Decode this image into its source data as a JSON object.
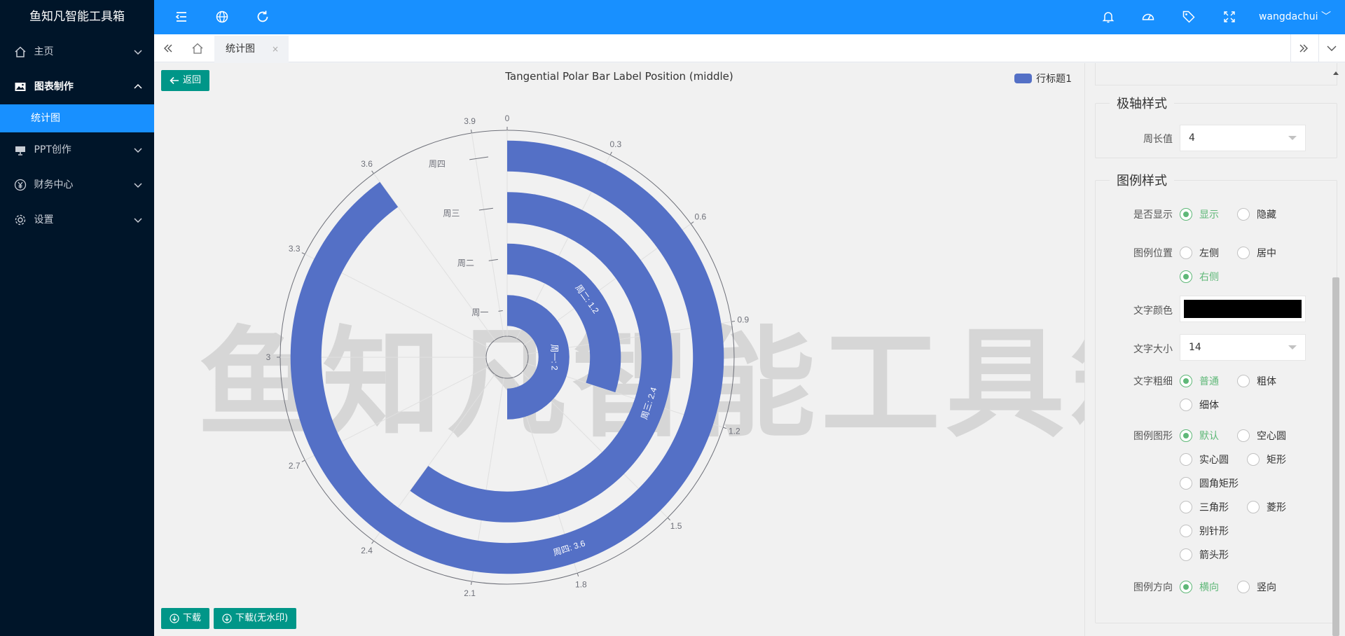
{
  "app": {
    "title": "鱼知凡智能工具箱"
  },
  "sidebar": {
    "items": [
      {
        "label": "主页",
        "icon": "home-icon"
      },
      {
        "label": "图表制作",
        "icon": "image-icon"
      },
      {
        "label": "PPT创作",
        "icon": "presentation-icon"
      },
      {
        "label": "财务中心",
        "icon": "yen-icon"
      },
      {
        "label": "设置",
        "icon": "gear-icon"
      }
    ],
    "active_sub": "统计图"
  },
  "topbar": {
    "icons": [
      "menu-fold-icon",
      "globe-icon",
      "refresh-icon",
      "bell-icon",
      "dashboard-icon",
      "tag-icon",
      "fullscreen-icon"
    ],
    "user": "wangdachui"
  },
  "tabs": {
    "active": "统计图",
    "close": "×"
  },
  "toolbar": {
    "back": "返回",
    "download": "下载",
    "download_nowm": "下载(无水印)"
  },
  "watermark": "鱼知凡智能工具箱",
  "chart_data": {
    "type": "bar",
    "coordinate_system": "polar",
    "bar_direction": "tangential",
    "title": "Tangential Polar Bar Label Position (middle)",
    "categories": [
      "周一",
      "周二",
      "周三",
      "周四"
    ],
    "series": [
      {
        "name": "行标题1",
        "values": [
          2,
          1.2,
          2.4,
          3.6
        ]
      }
    ],
    "data_labels": [
      "周一: 2",
      "周二: 1.2",
      "周三: 2.4",
      "周四: 3.6"
    ],
    "angle_axis": {
      "max": 4,
      "ticks": [
        "0",
        "0.3",
        "0.6",
        "0.9",
        "1.2",
        "1.5",
        "1.8",
        "2.1",
        "2.4",
        "2.7",
        "3",
        "3.3",
        "3.6",
        "3.9"
      ]
    },
    "legend": {
      "position": "top-right"
    },
    "color": "#5470c6"
  },
  "panel": {
    "polar_section": {
      "title": "极轴样式",
      "perimeter_label": "周长值",
      "perimeter_value": "4"
    },
    "legend_section": {
      "title": "图例样式",
      "show": {
        "label": "是否显示",
        "options": [
          "显示",
          "隐藏"
        ]
      },
      "position": {
        "label": "图例位置",
        "options": [
          "左侧",
          "居中",
          "右侧"
        ]
      },
      "text_color": {
        "label": "文字颜色",
        "value": "#000000"
      },
      "text_size": {
        "label": "文字大小",
        "value": "14"
      },
      "text_weight": {
        "label": "文字粗细",
        "options": [
          "普通",
          "粗体",
          "细体"
        ]
      },
      "shape": {
        "label": "图例图形",
        "options": [
          "默认",
          "空心圆",
          "实心圆",
          "矩形",
          "圆角矩形",
          "三角形",
          "菱形",
          "别针形",
          "箭头形"
        ]
      },
      "orient": {
        "label": "图例方向",
        "options": [
          "横向",
          "竖向"
        ]
      }
    }
  }
}
